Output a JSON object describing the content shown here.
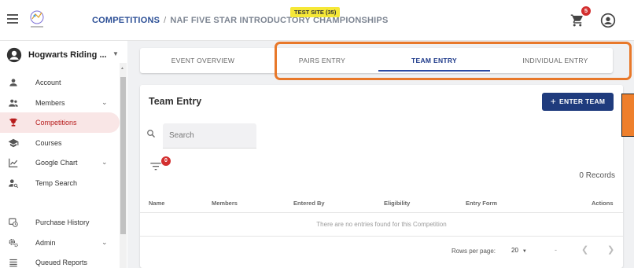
{
  "header": {
    "breadcrumb_root": "COMPETITIONS",
    "breadcrumb_sep": "/",
    "breadcrumb_current": "NAF FIVE STAR INTRODUCTORY CHAMPIONSHIPS",
    "test_badge": "TEST SITE (35)",
    "cart_count": "5"
  },
  "sidebar": {
    "org_name": "Hogwarts Riding ...",
    "items": [
      {
        "label": "Account",
        "icon": "person-icon"
      },
      {
        "label": "Members",
        "icon": "people-icon",
        "expandable": true
      },
      {
        "label": "Competitions",
        "icon": "trophy-icon",
        "active": true
      },
      {
        "label": "Courses",
        "icon": "school-icon"
      },
      {
        "label": "Google Chart",
        "icon": "chart-icon",
        "expandable": true
      },
      {
        "label": "Temp Search",
        "icon": "person-search-icon"
      },
      {
        "label": "Purchase History",
        "icon": "history-icon"
      },
      {
        "label": "Admin",
        "icon": "gears-icon",
        "expandable": true
      },
      {
        "label": "Queued Reports",
        "icon": "list-icon"
      }
    ]
  },
  "tabs": [
    {
      "label": "EVENT OVERVIEW",
      "active": false
    },
    {
      "label": "PAIRS ENTRY",
      "active": false
    },
    {
      "label": "TEAM ENTRY",
      "active": true
    },
    {
      "label": "INDIVIDUAL ENTRY",
      "active": false
    }
  ],
  "card": {
    "title": "Team Entry",
    "enter_button": "ENTER TEAM",
    "search_placeholder": "Search",
    "filter_count": "0",
    "records": "0 Records",
    "columns": [
      "Name",
      "Members",
      "Entered By",
      "Eligibility",
      "Entry Form",
      "Actions"
    ],
    "empty_message": "There are no entries found for this Competition",
    "rows_per_page_label": "Rows per page:",
    "rows_per_page_value": "20",
    "range": "-"
  },
  "colors": {
    "primary": "#1f3b7d",
    "active_tab": "#2a4aa3",
    "badge": "#d32f2f",
    "highlight": "#e8782a",
    "test_badge": "#f6e837"
  }
}
